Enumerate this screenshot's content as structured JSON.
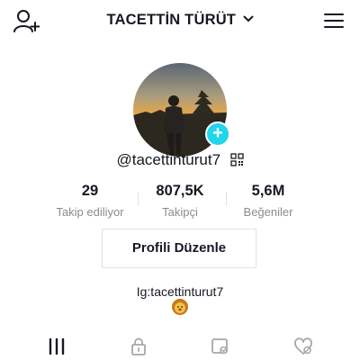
{
  "header": {
    "title": "TACETTİN TÜRÜT"
  },
  "profile": {
    "username": "@tacettinturut7",
    "bio": "Ig:tacettinturut7"
  },
  "stats": [
    {
      "value": "29",
      "label": "Takip ediliyor"
    },
    {
      "value": "807,5K",
      "label": "Takipçi"
    },
    {
      "value": "5,6M",
      "label": "Beğeniler"
    }
  ],
  "actions": {
    "edit_profile": "Profili Düzenle"
  },
  "colors": {
    "accent": "#20d5ec",
    "text": "#161823",
    "muted": "#8a8b91"
  },
  "icons": {
    "top_left": "add-user-icon",
    "top_right": "hamburger-menu-icon",
    "tabs": [
      "grid-icon",
      "lock-icon",
      "tagged-icon",
      "liked-icon"
    ]
  }
}
